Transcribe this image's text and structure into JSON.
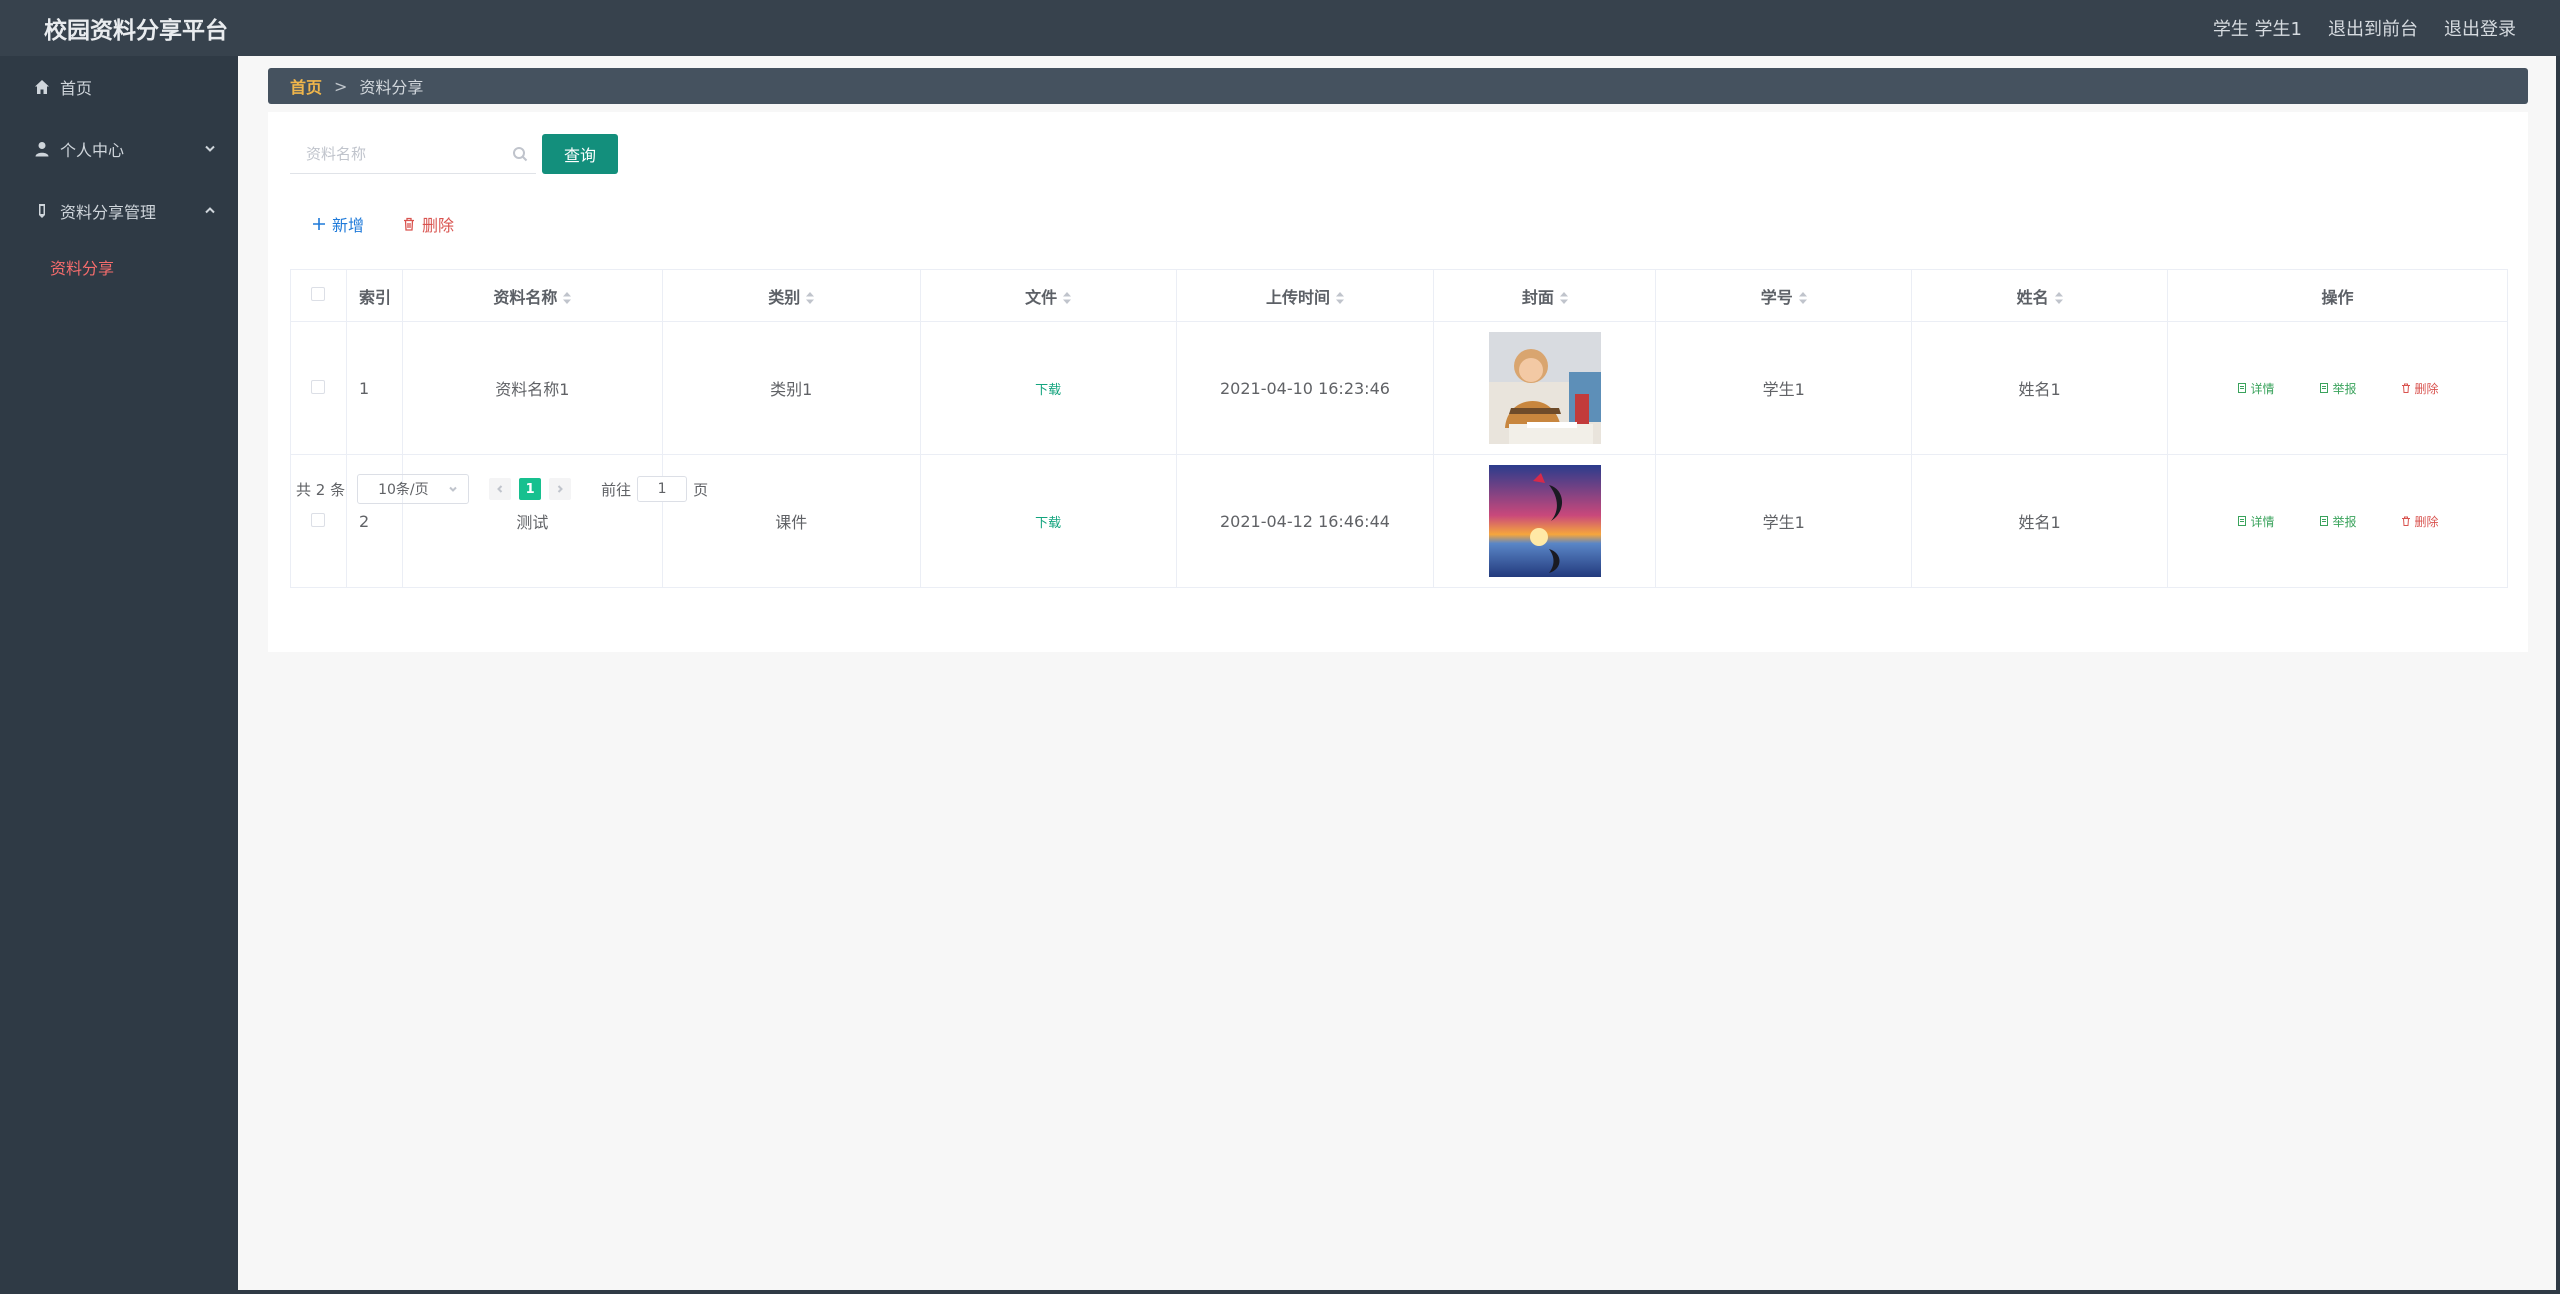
{
  "header": {
    "title": "校园资料分享平台",
    "user": "学生 学生1",
    "to_front": "退出到前台",
    "logout": "退出登录"
  },
  "sidebar": {
    "items": [
      {
        "label": "首页",
        "icon": "home-icon"
      },
      {
        "label": "个人中心",
        "icon": "user-icon"
      },
      {
        "label": "资料分享管理",
        "icon": "share-icon"
      }
    ],
    "sub_item": "资料分享"
  },
  "breadcrumb": {
    "home": "首页",
    "separator": ">",
    "current": "资料分享"
  },
  "search": {
    "placeholder": "资料名称",
    "button": "查询"
  },
  "actions": {
    "add": "新增",
    "delete": "删除"
  },
  "table": {
    "headers": [
      "索引",
      "资料名称",
      "类别",
      "文件",
      "上传时间",
      "封面",
      "学号",
      "姓名",
      "操作"
    ],
    "rows": [
      {
        "index": "1",
        "name": "资料名称1",
        "category": "类别1",
        "file": "下载",
        "time": "2021-04-10 16:23:46",
        "student_no": "学生1",
        "student_name": "姓名1"
      },
      {
        "index": "2",
        "name": "测试",
        "category": "课件",
        "file": "下载",
        "time": "2021-04-12 16:46:44",
        "student_no": "学生1",
        "student_name": "姓名1"
      }
    ],
    "ops": {
      "detail": "详情",
      "report": "举报",
      "remove": "删除"
    }
  },
  "pagination": {
    "total": "共 2 条",
    "page_size": "10条/页",
    "current_page": "1",
    "goto_prefix": "前往",
    "goto_value": "1",
    "goto_suffix": "页"
  },
  "colors": {
    "accent": "#138f7c",
    "active_menu": "#f56c6c",
    "breadcrumb_home": "#f0b64b"
  }
}
